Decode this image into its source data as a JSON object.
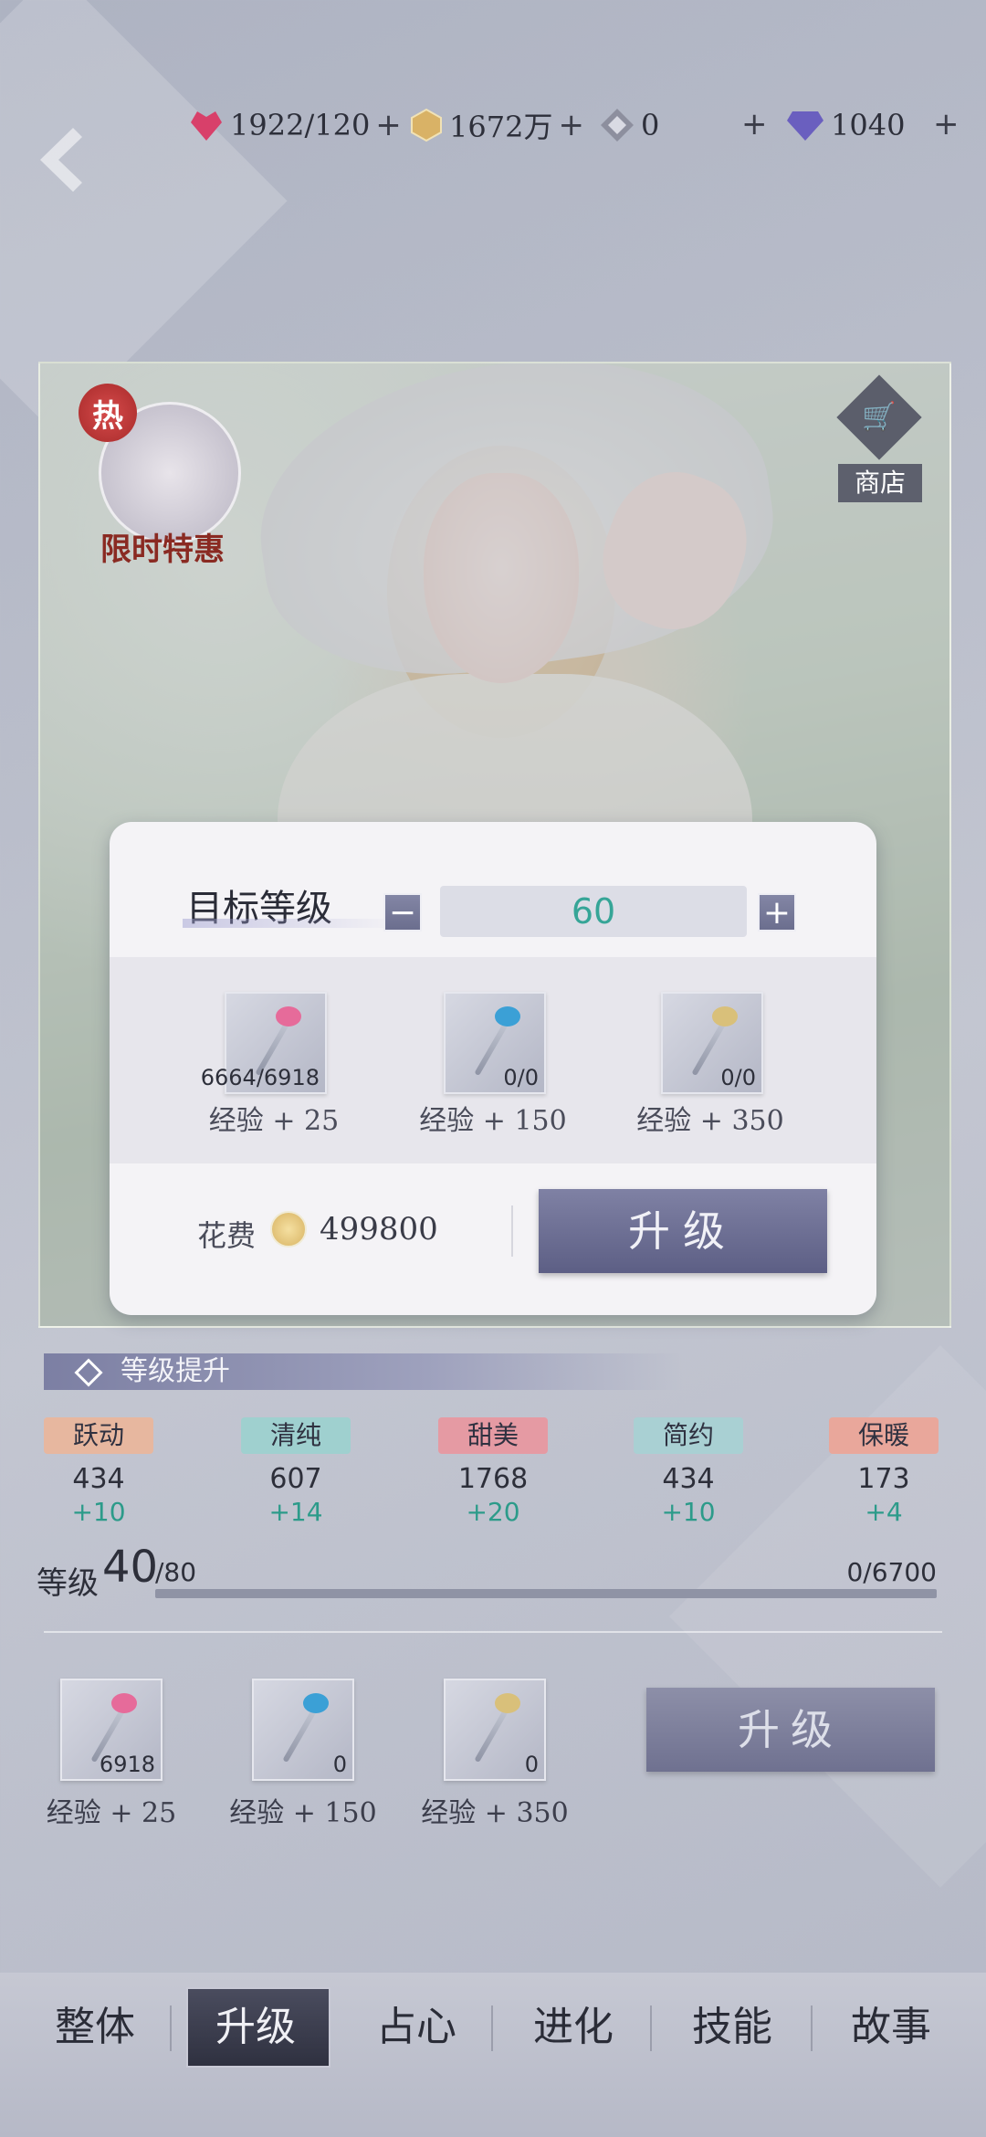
{
  "resources": {
    "stamina": "1922/120",
    "gold": "1672万",
    "crystal": "0",
    "diamond": "1040"
  },
  "card": {
    "hot_badge": "热",
    "promo_label": "限时特惠",
    "shop_label": "商店"
  },
  "dialog": {
    "title": "目标等级",
    "target_level": "60",
    "items": [
      {
        "count": "6664/6918",
        "exp": "经验 + 25",
        "color": "#e66b9a"
      },
      {
        "count": "0/0",
        "exp": "经验 + 150",
        "color": "#3ba0d6"
      },
      {
        "count": "0/0",
        "exp": "经验 + 350",
        "color": "#d9c07a"
      }
    ],
    "cost_label": "花费",
    "cost_value": "499800",
    "upgrade_label": "升级"
  },
  "level_section": {
    "title": "等级提升",
    "attributes": [
      {
        "name": "跃动",
        "value": "434",
        "inc": "+10",
        "color": "#e7b79f"
      },
      {
        "name": "清纯",
        "value": "607",
        "inc": "+14",
        "color": "#9fd0cf"
      },
      {
        "name": "甜美",
        "value": "1768",
        "inc": "+20",
        "color": "#e59aa3"
      },
      {
        "name": "简约",
        "value": "434",
        "inc": "+10",
        "color": "#a9d0d3"
      },
      {
        "name": "保暖",
        "value": "173",
        "inc": "+4",
        "color": "#e9a79b"
      }
    ],
    "level_label": "等级",
    "level": "40",
    "level_max": "/80",
    "exp_progress": "0/6700",
    "items": [
      {
        "count": "6918",
        "exp": "经验 + 25"
      },
      {
        "count": "0",
        "exp": "经验 + 150"
      },
      {
        "count": "0",
        "exp": "经验 + 350"
      }
    ],
    "upgrade_label": "升级"
  },
  "nav": [
    "整体",
    "升级",
    "占心",
    "进化",
    "技能",
    "故事"
  ],
  "nav_active_index": 1
}
